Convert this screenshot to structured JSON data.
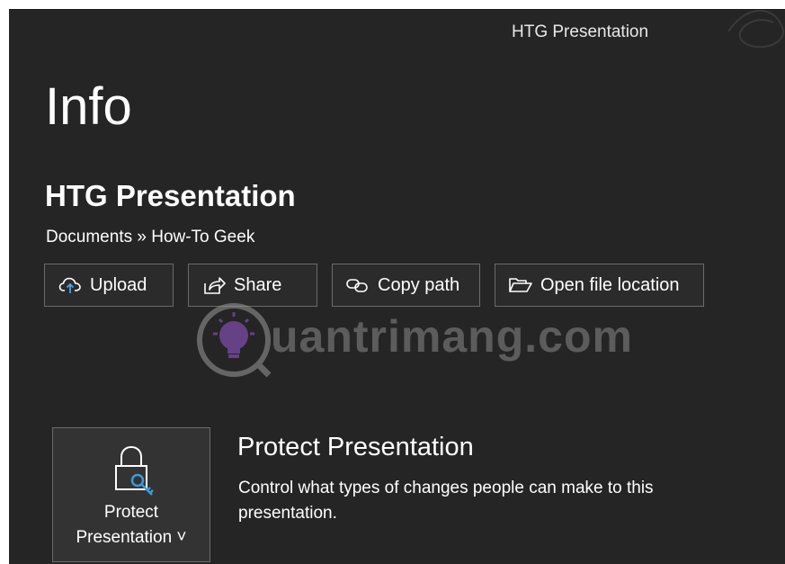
{
  "window": {
    "title": "HTG Presentation"
  },
  "page": {
    "heading": "Info"
  },
  "file": {
    "name": "HTG Presentation",
    "breadcrumb": "Documents » How-To Geek"
  },
  "actions": [
    {
      "label": "Upload",
      "icon": "cloud-upload-icon"
    },
    {
      "label": "Share",
      "icon": "share-icon"
    },
    {
      "label": "Copy path",
      "icon": "link-icon"
    },
    {
      "label": "Open file location",
      "icon": "folder-open-icon"
    }
  ],
  "protect": {
    "tile_line1": "Protect",
    "tile_line2": "Presentation ˅",
    "icon": "lock-key-icon",
    "title": "Protect Presentation",
    "description": "Control what types of changes people can make to this presentation."
  },
  "watermark": {
    "text": "uantrimang.com"
  },
  "colors": {
    "background": "#252525",
    "button_border": "#6b6b6b",
    "tile_background": "#333333",
    "key_blue": "#3a9bdc"
  }
}
